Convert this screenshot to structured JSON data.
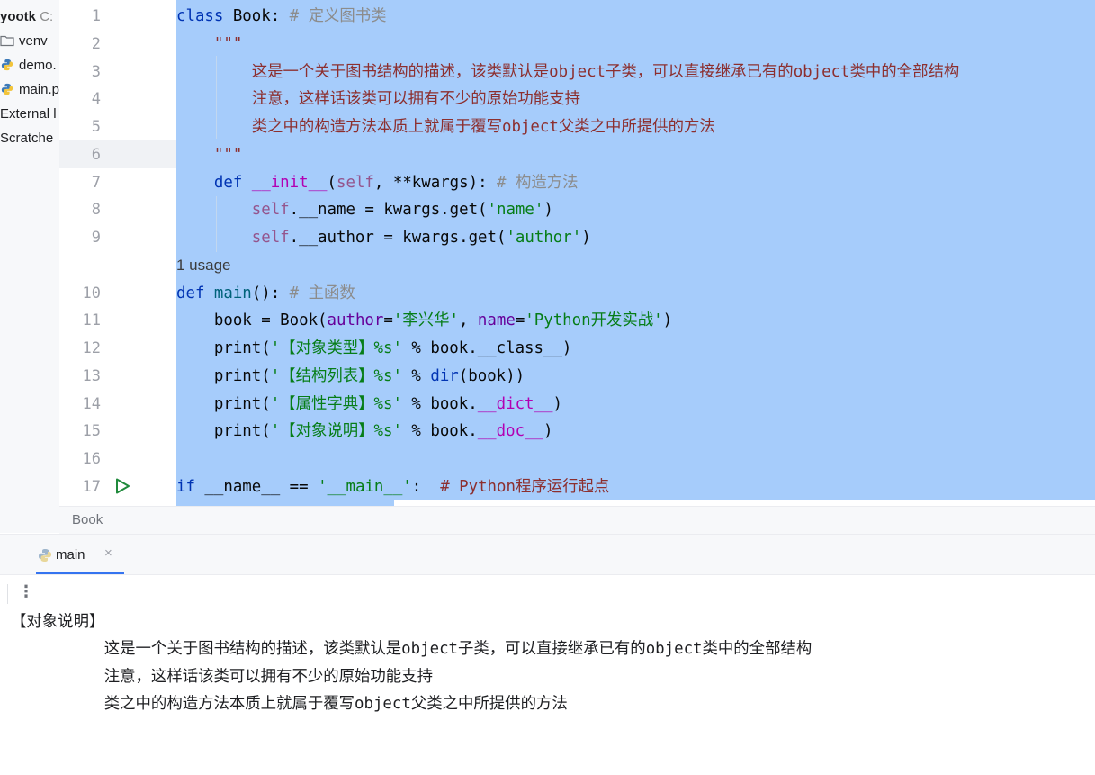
{
  "project_panel": {
    "items": [
      {
        "label": "yootk",
        "suffix": "C:",
        "icon": "project-root"
      },
      {
        "label": "venv",
        "icon": "folder-icon"
      },
      {
        "label": "demo.",
        "icon": "python-file-icon"
      },
      {
        "label": "main.p",
        "icon": "python-file-icon"
      },
      {
        "label": "External l",
        "icon": ""
      },
      {
        "label": "Scratche",
        "icon": ""
      }
    ]
  },
  "editor": {
    "line_numbers": [
      "1",
      "2",
      "3",
      "4",
      "5",
      "6",
      "7",
      "8",
      "9",
      "10",
      "11",
      "12",
      "13",
      "14",
      "15",
      "16",
      "17"
    ],
    "usage_hint": "1 usage",
    "lines": {
      "l1_kw": "class",
      "l1_name": " Book: ",
      "l1_cm": "# 定义图书类",
      "l2": "    \"\"\"",
      "l3": "        这是一个关于图书结构的描述，该类默认是object子类，可以直接继承已有的object类中的全部结构",
      "l4": "        注意，这样话该类可以拥有不少的原始功能支持",
      "l5": "        类之中的构造方法本质上就属于覆写object父类之中所提供的方法",
      "l6": "    \"\"\"",
      "l7_kw": "    def ",
      "l7_fn": "__init__",
      "l7_p1": "(",
      "l7_self": "self",
      "l7_p2": ", **kwargs): ",
      "l7_cm": "# 构造方法",
      "l8_self": "        self",
      "l8_a": ".__name = kwargs.get(",
      "l8_s": "'name'",
      "l8_b": ")",
      "l9_self": "        self",
      "l9_a": ".__author = kwargs.get(",
      "l9_s": "'author'",
      "l9_b": ")",
      "l10_kw": "def ",
      "l10_fn": "main",
      "l10_a": "(): ",
      "l10_cm": "# 主函数",
      "l11_a": "    book = Book(",
      "l11_p1": "author",
      "l11_b": "=",
      "l11_s1": "'李兴华'",
      "l11_c": ", ",
      "l11_p2": "name",
      "l11_d": "=",
      "l11_s2": "'Python开发实战'",
      "l11_e": ")",
      "l12_a": "    print(",
      "l12_s": "'【对象类型】%s'",
      "l12_b": " % book.__class__)",
      "l13_a": "    print(",
      "l13_s": "'【结构列表】%s'",
      "l13_b": " % ",
      "l13_fn": "dir",
      "l13_c": "(book))",
      "l14_a": "    print(",
      "l14_s": "'【属性字典】%s'",
      "l14_b": " % book.",
      "l14_d": "__dict__",
      "l14_c": ")",
      "l15_a": "    print(",
      "l15_s": "'【对象说明】%s'",
      "l15_b": " % book.",
      "l15_d": "__doc__",
      "l15_c": ")",
      "l17_kw": "if",
      "l17_a": " __name__ == ",
      "l17_s": "'__main__'",
      "l17_b": ":  ",
      "l17_cm": "# Python程序运行起点"
    }
  },
  "breadcrumb": "Book",
  "run_panel": {
    "tab_label": "main",
    "close_glyph": "×",
    "menu_glyph": "⋮",
    "output": [
      "【对象说明】",
      "        这是一个关于图书结构的描述，该类默认是object子类，可以直接继承已有的object类中的全部结构",
      "        注意，这样话该类可以拥有不少的原始功能支持",
      "        类之中的构造方法本质上就属于覆写object父类之中所提供的方法"
    ]
  },
  "colors": {
    "selection": "#a6ccfb",
    "keyword": "#0033b3",
    "string": "#067d17",
    "docstring": "#8c2f2f",
    "accent": "#3574f0"
  }
}
